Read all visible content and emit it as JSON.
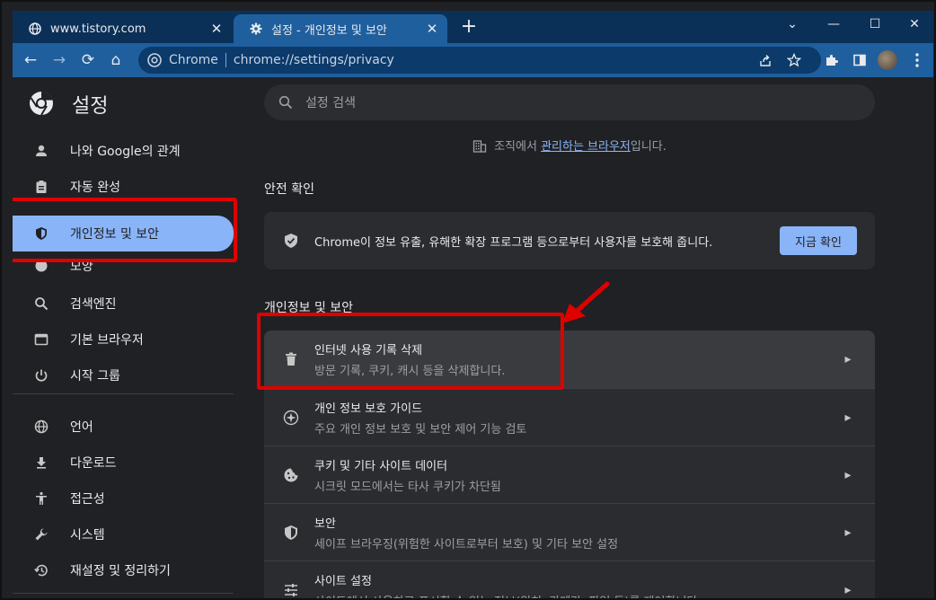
{
  "tabs": [
    {
      "title": "www.tistory.com",
      "icon": "globe-icon",
      "close": "✕"
    },
    {
      "title": "설정 - 개인정보 및 보안",
      "icon": "gear-icon",
      "close": "✕"
    }
  ],
  "new_tab": "+",
  "window_controls": {
    "tabsearch": "⌄",
    "minimize": "—",
    "maximize": "☐",
    "close": "✕"
  },
  "toolbar": {
    "back": "←",
    "forward": "→",
    "reload": "⟳",
    "home": "⌂",
    "omnibox": {
      "chrome_label": "Chrome",
      "url": "chrome://settings/privacy"
    }
  },
  "settings": {
    "title": "설정",
    "search_placeholder": "설정 검색"
  },
  "sidebar": {
    "items": [
      {
        "label": "나와 Google의 관계",
        "icon": "person-icon"
      },
      {
        "label": "자동 완성",
        "icon": "clipboard-icon"
      },
      {
        "label": "개인정보 및 보안",
        "icon": "shield-icon",
        "selected": true
      },
      {
        "label": "모양",
        "icon": "palette-icon"
      },
      {
        "label": "검색엔진",
        "icon": "search-icon"
      },
      {
        "label": "기본 브라우저",
        "icon": "browser-icon"
      },
      {
        "label": "시작 그룹",
        "icon": "power-icon"
      },
      {
        "label": "언어",
        "icon": "globe-icon"
      },
      {
        "label": "다운로드",
        "icon": "download-icon"
      },
      {
        "label": "접근성",
        "icon": "accessibility-icon"
      },
      {
        "label": "시스템",
        "icon": "wrench-icon"
      },
      {
        "label": "재설정 및 정리하기",
        "icon": "restore-icon"
      }
    ]
  },
  "main": {
    "managed": {
      "prefix": "조직에서 ",
      "link": "관리하는 브라우저",
      "suffix": "입니다."
    },
    "safety_check": {
      "section_title": "안전 확인",
      "text": "Chrome이 정보 유출, 유해한 확장 프로그램 등으로부터 사용자를 보호해 줍니다.",
      "button": "지금 확인"
    },
    "privacy": {
      "section_title": "개인정보 및 보안",
      "rows": [
        {
          "title": "인터넷 사용 기록 삭제",
          "subtitle": "방문 기록, 쿠키, 캐시 등을 삭제합니다.",
          "icon": "trash-icon"
        },
        {
          "title": "개인 정보 보호 가이드",
          "subtitle": "주요 개인 정보 보호 및 보안 제어 기능 검토",
          "icon": "compass-icon"
        },
        {
          "title": "쿠키 및 기타 사이트 데이터",
          "subtitle": "시크릿 모드에서는 타사 쿠키가 차단됨",
          "icon": "cookie-icon"
        },
        {
          "title": "보안",
          "subtitle": "세이프 브라우징(위험한 사이트로부터 보호) 및 기타 보안 설정",
          "icon": "shield-icon"
        },
        {
          "title": "사이트 설정",
          "subtitle": "사이트에서 사용하고 표시할 수 있는 정보(위치, 카메라, 팝업 등)를 제어합니다.",
          "icon": "sliders-icon"
        }
      ]
    }
  },
  "colors": {
    "highlight": "#e00000",
    "accent": "#8ab4f8",
    "tab_bar": "#0b3058",
    "toolbar": "#1f5f9e"
  }
}
